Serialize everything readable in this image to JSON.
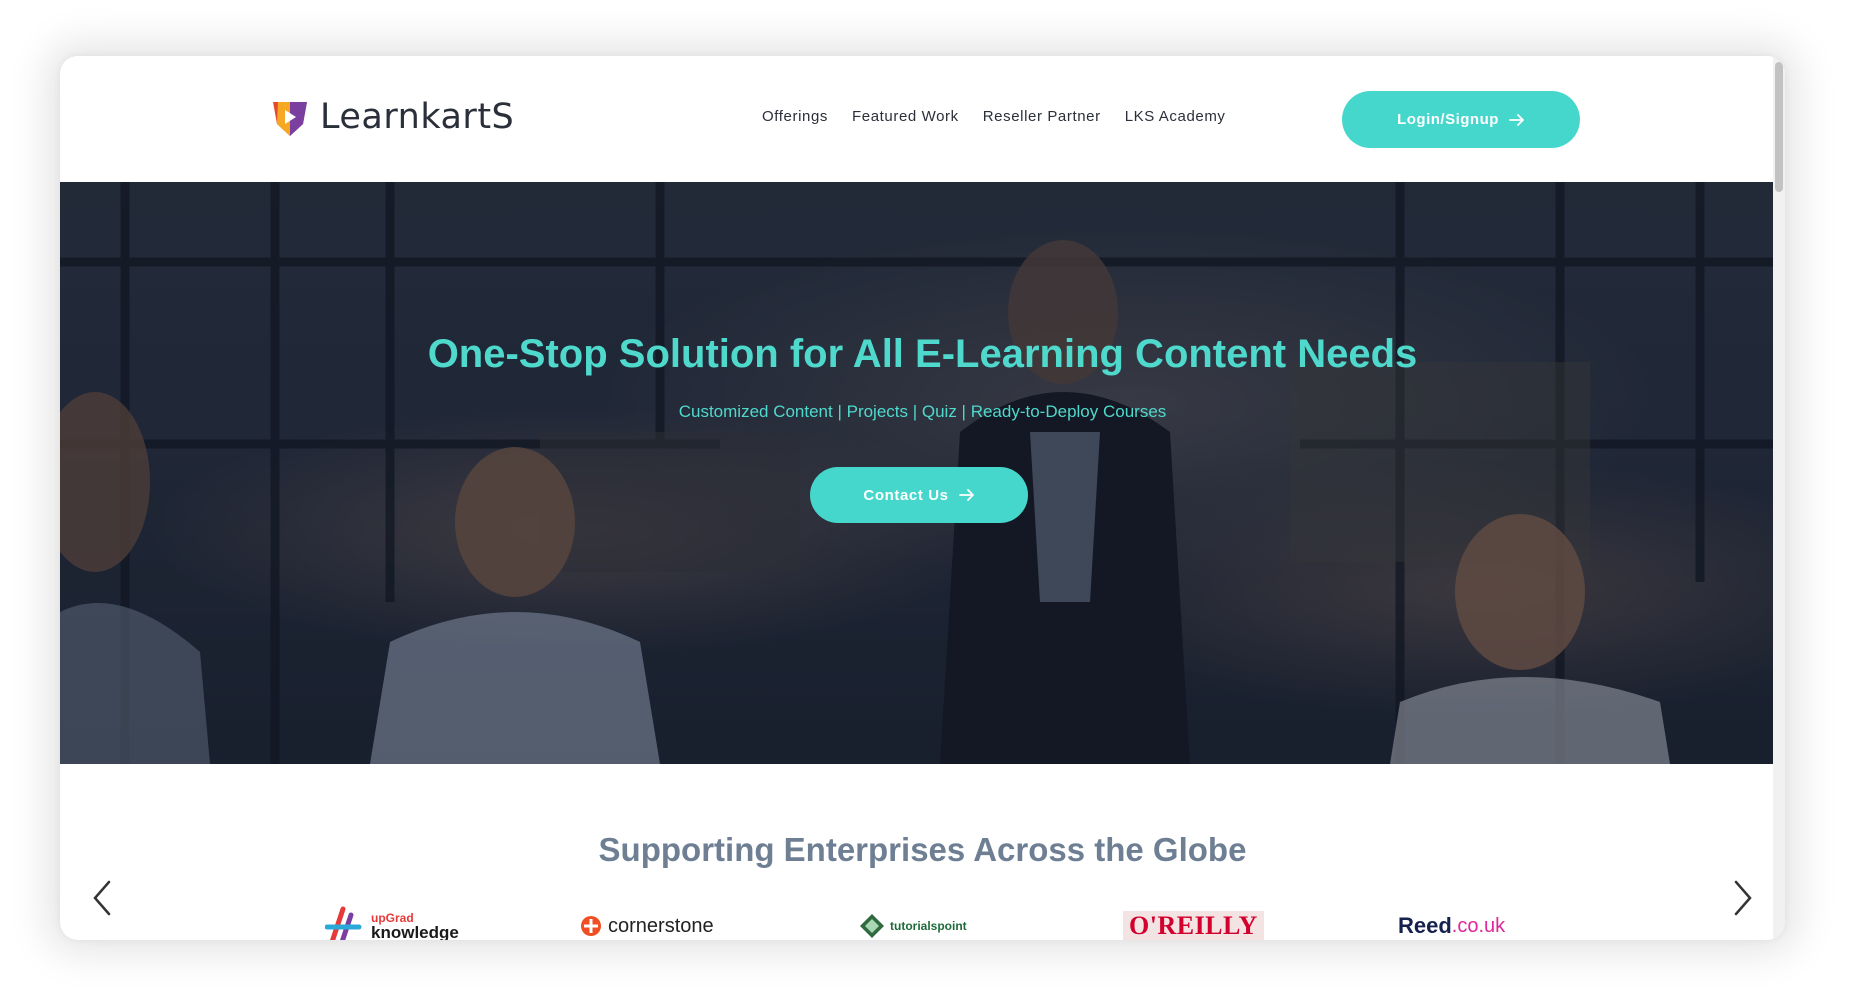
{
  "brand": {
    "name": "LearnkartS"
  },
  "nav": {
    "items": [
      {
        "label": "Offerings"
      },
      {
        "label": "Featured Work"
      },
      {
        "label": "Reseller Partner"
      },
      {
        "label": "LKS Academy"
      }
    ],
    "login_label": "Login/Signup"
  },
  "hero": {
    "title": "One-Stop Solution for All E-Learning Content Needs",
    "subtitle": "Customized Content | Projects | Quiz | Ready-to-Deploy Courses",
    "cta_label": "Contact Us"
  },
  "clients": {
    "title": "Supporting Enterprises Across the Globe",
    "logos": [
      {
        "top": "upGrad",
        "bottom": "knowledge"
      },
      {
        "text": "cornerstone"
      },
      {
        "text": "tutorialspoint"
      },
      {
        "text": "O'REILLY"
      },
      {
        "text": "Reed",
        "suffix": ".co.uk"
      }
    ]
  },
  "colors": {
    "accent": "#45d7cb",
    "heading_teal": "#4fd9cc",
    "section_title": "#6e7f94",
    "nav_text": "#2a2f3a"
  },
  "icons": [
    "logo-mark-icon",
    "arrow-right-icon",
    "chevron-left-icon",
    "chevron-right-icon",
    "cornerstone-icon",
    "tutorialspoint-icon",
    "upgrad-icon"
  ]
}
